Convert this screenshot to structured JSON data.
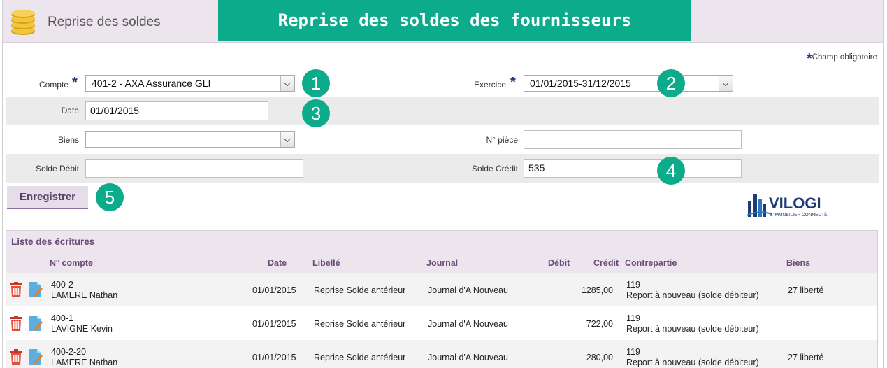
{
  "header": {
    "title": "Reprise des soldes",
    "banner": "Reprise des soldes des fournisseurs"
  },
  "form": {
    "required_note": "Champ obligatoire",
    "compte": {
      "label": "Compte",
      "value": "401-2 - AXA Assurance GLI"
    },
    "exercice": {
      "label": "Exercice",
      "value": "01/01/2015-31/12/2015"
    },
    "date": {
      "label": "Date",
      "value": "01/01/2015"
    },
    "biens": {
      "label": "Biens",
      "value": ""
    },
    "piece": {
      "label": "N° pièce",
      "value": ""
    },
    "solde_debit": {
      "label": "Solde Débit",
      "value": ""
    },
    "solde_credit": {
      "label": "Solde Crédit",
      "value": "535"
    },
    "save_label": "Enregistrer"
  },
  "callouts": [
    "1",
    "2",
    "3",
    "4",
    "5"
  ],
  "logo": {
    "name": "VILOGI",
    "tagline": "L'IMMOBILIER CONNECTÉ"
  },
  "colors": {
    "accent": "#0bab8c",
    "header_bg": "#ede5ee",
    "heading_text": "#6b4a78"
  },
  "list": {
    "title": "Liste des écritures",
    "columns": {
      "compte": "N° compte",
      "date": "Date",
      "libelle": "Libellé",
      "journal": "Journal",
      "debit": "Débit",
      "credit": "Crédit",
      "contrepartie": "Contrepartie",
      "biens": "Biens"
    },
    "rows": [
      {
        "compte": "400-2",
        "nom": "LAMERE Nathan",
        "date": "01/01/2015",
        "libelle": "Reprise Solde antérieur",
        "journal": "Journal d'A Nouveau",
        "debit": "",
        "credit": "1285,00",
        "contre_num": "119",
        "contre_lib": "Report à nouveau (solde débiteur)",
        "biens": "27 liberté"
      },
      {
        "compte": "400-1",
        "nom": "LAVIGNE Kevin",
        "date": "01/01/2015",
        "libelle": "Reprise Solde antérieur",
        "journal": "Journal d'A Nouveau",
        "debit": "",
        "credit": "722,00",
        "contre_num": "119",
        "contre_lib": "Report à nouveau (solde débiteur)",
        "biens": ""
      },
      {
        "compte": "400-2-20",
        "nom": "LAMERE Nathan",
        "date": "01/01/2015",
        "libelle": "Reprise Solde antérieur",
        "journal": "Journal d'A Nouveau",
        "debit": "",
        "credit": "280,00",
        "contre_num": "119",
        "contre_lib": "Report à nouveau (solde débiteur)",
        "biens": "27 liberté"
      }
    ]
  }
}
